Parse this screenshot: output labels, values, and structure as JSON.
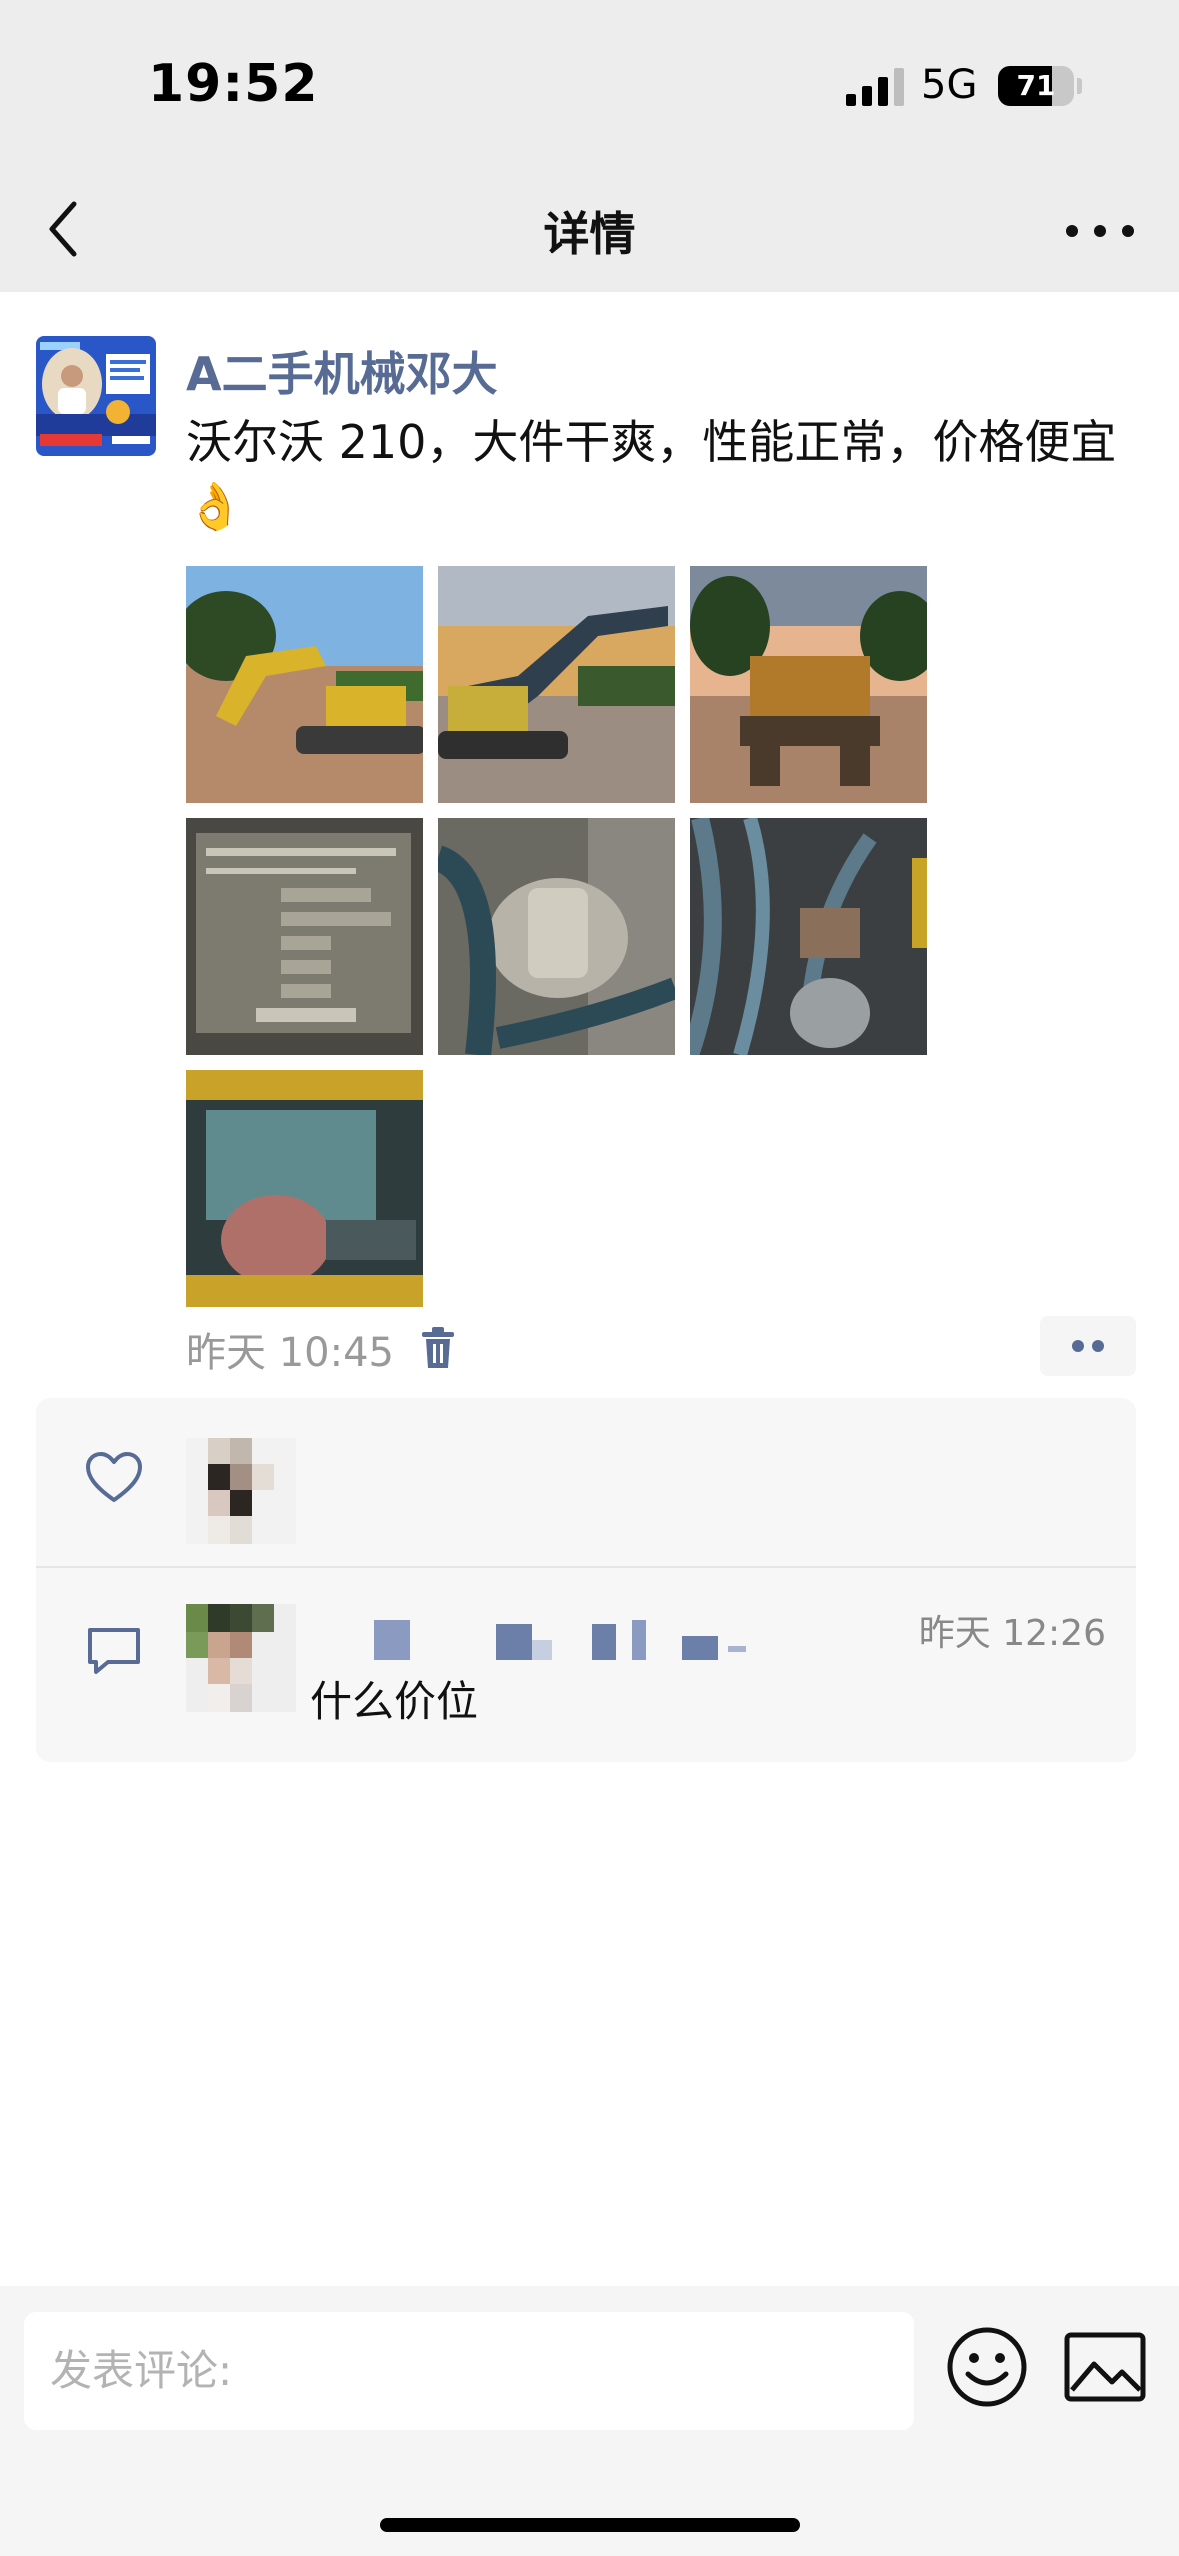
{
  "status_bar": {
    "time": "19:52",
    "network": "5G",
    "battery": 71,
    "battery_label": "71"
  },
  "nav": {
    "title": "详情",
    "back_icon": "chevron-left-icon",
    "more_icon": "more-dots-icon"
  },
  "post": {
    "author": "A二手机械邓大",
    "text": "沃尔沃 210，大件干爽，性能正常，价格便宜👌",
    "photos": [
      {
        "name": "excavator-side-view"
      },
      {
        "name": "excavator-sunset-view"
      },
      {
        "name": "excavator-rear-view"
      },
      {
        "name": "volvo-nameplate"
      },
      {
        "name": "hydraulic-pump"
      },
      {
        "name": "swing-motor-hoses"
      },
      {
        "name": "engine-bay"
      }
    ],
    "time": "昨天 10:45",
    "delete_icon": "trash-icon",
    "actions_icon": "more-dots-icon"
  },
  "interactions": {
    "like_icon": "heart-icon",
    "comment_icon": "comment-bubble-icon",
    "comment": {
      "time": "昨天 12:26",
      "text": "什么价位"
    }
  },
  "composer": {
    "placeholder": "发表评论:",
    "emoji_icon": "smiley-icon",
    "image_icon": "image-icon"
  },
  "colors": {
    "link_name": "#576b95",
    "header_bg": "#ededed",
    "panel_bg": "#f7f7f7"
  }
}
